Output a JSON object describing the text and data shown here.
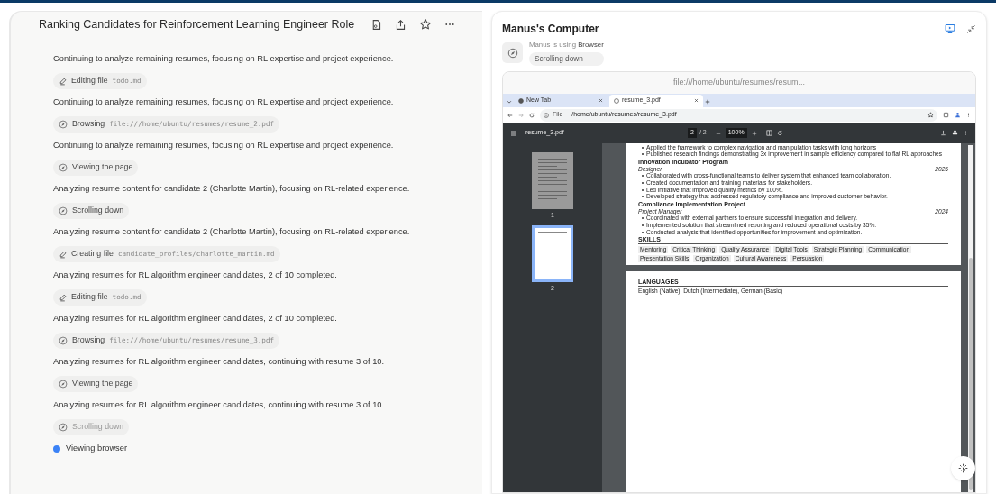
{
  "task_panel": {
    "title": "Ranking Candidates for Reinforcement Learning Engineer Role",
    "steps": [
      {
        "kind": "message",
        "text": "Continuing to analyze remaining resumes, focusing on RL expertise and project experience."
      },
      {
        "kind": "file_action",
        "verb": "Editing file",
        "target": "todo.md",
        "faded": false
      },
      {
        "kind": "message",
        "text": "Continuing to analyze remaining resumes, focusing on RL expertise and project experience."
      },
      {
        "kind": "browser_action",
        "verb": "Browsing",
        "target": "file:///home/ubuntu/resumes/resume_2.pdf",
        "faded": false
      },
      {
        "kind": "message",
        "text": "Continuing to analyze remaining resumes, focusing on RL expertise and project experience."
      },
      {
        "kind": "browser_action",
        "verb": "Viewing the page",
        "faded": false
      },
      {
        "kind": "message",
        "text": "Analyzing resume content for candidate 2 (Charlotte Martin), focusing on RL-related experience."
      },
      {
        "kind": "browser_action",
        "verb": "Scrolling down",
        "faded": false
      },
      {
        "kind": "message",
        "text": "Analyzing resume content for candidate 2 (Charlotte Martin), focusing on RL-related experience."
      },
      {
        "kind": "file_action",
        "verb": "Creating file",
        "target": "candidate_profiles/charlotte_martin.md",
        "faded": false
      },
      {
        "kind": "message",
        "text": "Analyzing resumes for RL algorithm engineer candidates, 2 of 10 completed."
      },
      {
        "kind": "file_action",
        "verb": "Editing file",
        "target": "todo.md",
        "faded": false
      },
      {
        "kind": "message",
        "text": "Analyzing resumes for RL algorithm engineer candidates, 2 of 10 completed."
      },
      {
        "kind": "browser_action",
        "verb": "Browsing",
        "target": "file:///home/ubuntu/resumes/resume_3.pdf",
        "faded": false
      },
      {
        "kind": "message",
        "text": "Analyzing resumes for RL algorithm engineer candidates, continuing with resume 3 of 10."
      },
      {
        "kind": "browser_action",
        "verb": "Viewing the page",
        "faded": false
      },
      {
        "kind": "message",
        "text": "Analyzing resumes for RL algorithm engineer candidates, continuing with resume 3 of 10."
      },
      {
        "kind": "browser_action",
        "verb": "Scrolling down",
        "faded": true
      }
    ],
    "status": "Viewing browser"
  },
  "computer_panel": {
    "title": "Manus's Computer",
    "tool_label": "Manus is using",
    "tool_name": "Browser",
    "action": "Scrolling down",
    "browser": {
      "url_header": "file:///home/ubuntu/resumes/resum...",
      "tabs": [
        {
          "label": "New Tab",
          "selected": false
        },
        {
          "label": "resume_3.pdf",
          "selected": true
        }
      ],
      "address_scheme": "File",
      "address": "/home/ubuntu/resumes/resume_3.pdf",
      "pdf": {
        "file_name": "resume_3.pdf",
        "page": "2",
        "page_total": "/ 2",
        "zoom": "100%",
        "thumbnails": [
          {
            "label": "1",
            "selected": false
          },
          {
            "label": "2",
            "selected": true
          }
        ],
        "page_1": {
          "bullets": [
            "Applied the framework to complex navigation and manipulation tasks with long horizons",
            "Published research findings demonstrating 3x improvement in sample efficiency compared to flat RL approaches"
          ],
          "projects": [
            {
              "title": "Innovation Incubator Program",
              "role": "Designer",
              "year": "2025",
              "bullets": [
                "Collaborated with cross-functional teams to deliver system that enhanced team collaboration.",
                "Created documentation and training materials for stakeholders.",
                "Led initiative that improved quality metrics by 100%.",
                "Developed strategy that addressed regulatory compliance and improved customer behavior."
              ]
            },
            {
              "title": "Compliance Implementation Project",
              "role": "Project Manager",
              "year": "2024",
              "bullets": [
                "Coordinated with external partners to ensure successful integration and delivery.",
                "Implemented solution that streamlined reporting and reduced operational costs by 35%.",
                "Conducted analysis that identified opportunities for improvement and optimization."
              ]
            }
          ],
          "skills_heading": "SKILLS",
          "skills": [
            "Mentoring",
            "Critical Thinking",
            "Quality Assurance",
            "Digital Tools",
            "Strategic Planning",
            "Communication",
            "Presentation Skills",
            "Organization",
            "Cultural Awareness",
            "Persuasion"
          ]
        },
        "page_2": {
          "heading": "LANGUAGES",
          "text": "English (Native), Dutch (Intermediate), German (Basic)"
        }
      }
    }
  }
}
